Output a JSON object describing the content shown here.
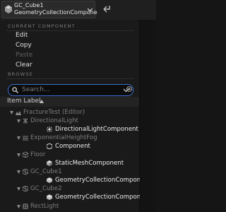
{
  "component_selector": {
    "line1": "GC_Cube1",
    "line2": "GeometryCollectionCompone"
  },
  "current_component": {
    "header": "CURRENT COMPONENT",
    "items": [
      {
        "label": "Edit",
        "enabled": true
      },
      {
        "label": "Copy",
        "enabled": true
      },
      {
        "label": "Paste",
        "enabled": false
      },
      {
        "label": "Clear",
        "enabled": true
      }
    ]
  },
  "browse": {
    "header": "BROWSE",
    "search_placeholder": "Search...",
    "column_label": "Item Label"
  },
  "tree": [
    {
      "label": "FractureTest (Editor)",
      "style": "muted",
      "icon": "world-icon"
    },
    {
      "label": "DirectionalLight",
      "style": "muted",
      "icon": "light-icon"
    },
    {
      "label": "DirectionalLightComponent",
      "style": "bright",
      "icon": "sun-icon"
    },
    {
      "label": "ExponentialHeightFog",
      "style": "muted",
      "icon": "fog-icon"
    },
    {
      "label": "Component",
      "style": "bright",
      "icon": "component-icon"
    },
    {
      "label": "Floor",
      "style": "muted",
      "icon": "mesh-actor-icon"
    },
    {
      "label": "StaticMeshComponent",
      "style": "bright",
      "icon": "cube-icon"
    },
    {
      "label": "GC_Cube1",
      "style": "muted",
      "icon": "geometry-actor-icon"
    },
    {
      "label": "GeometryCollectionComponent",
      "style": "bright",
      "icon": "geometry-collection-icon"
    },
    {
      "label": "GC_Cube2",
      "style": "muted",
      "icon": "geometry-actor-icon"
    },
    {
      "label": "GeometryCollectionComponent",
      "style": "bright",
      "icon": "geometry-collection-icon"
    },
    {
      "label": "RectLight",
      "style": "muted",
      "icon": "rect-light-icon"
    }
  ]
}
